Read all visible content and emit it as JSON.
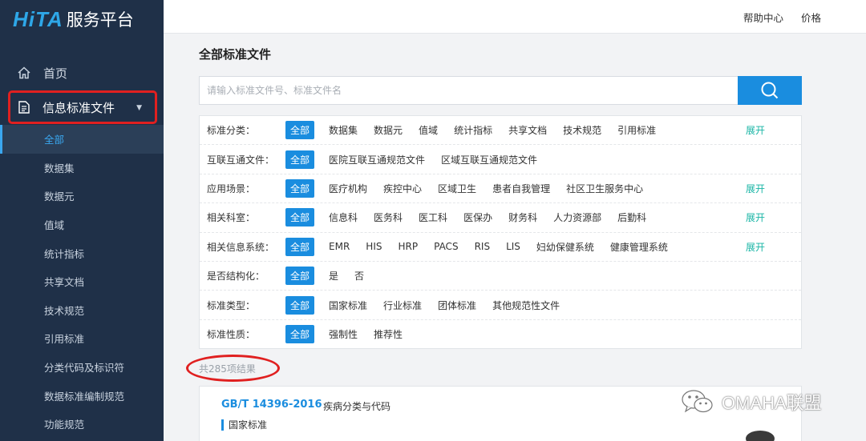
{
  "logo": {
    "mark": "HiTA",
    "text": "服务平台"
  },
  "topbar": {
    "help": "帮助中心",
    "price": "价格"
  },
  "sidebar": {
    "home": "首页",
    "group": "信息标准文件",
    "items": [
      "全部",
      "数据集",
      "数据元",
      "值域",
      "统计指标",
      "共享文档",
      "技术规范",
      "引用标准",
      "分类代码及标识符",
      "数据标准编制规范",
      "功能规范"
    ]
  },
  "main": {
    "title": "全部标准文件",
    "search_placeholder": "请输入标准文件号、标准文件名",
    "filters": [
      {
        "label": "标准分类：",
        "options": [
          "全部",
          "数据集",
          "数据元",
          "值域",
          "统计指标",
          "共享文档",
          "技术规范",
          "引用标准"
        ],
        "expand": "展开"
      },
      {
        "label": "互联互通文件：",
        "options": [
          "全部",
          "医院互联互通规范文件",
          "区域互联互通规范文件"
        ],
        "expand": ""
      },
      {
        "label": "应用场景：",
        "options": [
          "全部",
          "医疗机构",
          "疾控中心",
          "区域卫生",
          "患者自我管理",
          "社区卫生服务中心"
        ],
        "expand": "展开"
      },
      {
        "label": "相关科室：",
        "options": [
          "全部",
          "信息科",
          "医务科",
          "医工科",
          "医保办",
          "财务科",
          "人力资源部",
          "后勤科"
        ],
        "expand": "展开"
      },
      {
        "label": "相关信息系统：",
        "options": [
          "全部",
          "EMR",
          "HIS",
          "HRP",
          "PACS",
          "RIS",
          "LIS",
          "妇幼保健系统",
          "健康管理系统"
        ],
        "expand": "展开"
      },
      {
        "label": "是否结构化：",
        "options": [
          "全部",
          "是",
          "否"
        ],
        "expand": ""
      },
      {
        "label": "标准类型：",
        "options": [
          "全部",
          "国家标准",
          "行业标准",
          "团体标准",
          "其他规范性文件"
        ],
        "expand": ""
      },
      {
        "label": "标准性质：",
        "options": [
          "全部",
          "强制性",
          "推荐性"
        ],
        "expand": ""
      }
    ],
    "result_count": "共285项结果",
    "result": {
      "code": "GB/T 14396-2016",
      "name": "疾病分类与代码",
      "tag": "国家标准"
    }
  },
  "watermark": "OMAHA联盟",
  "colors": {
    "accent": "#1a8ddf",
    "sidebar": "#1f3048",
    "expand": "#19b5a5",
    "highlight": "#e02020"
  }
}
